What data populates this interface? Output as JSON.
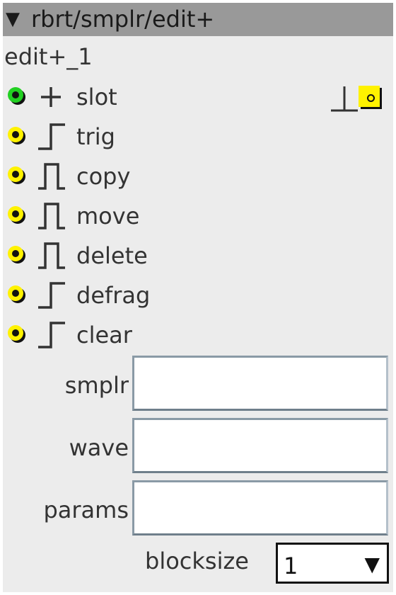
{
  "window": {
    "title": "rbrt/smplr/edit+",
    "collapse_glyph": "▼"
  },
  "node": {
    "name": "edit+_1"
  },
  "colors": {
    "port_green": "#22d022",
    "port_yellow": "#fff200",
    "titlebar": "#999999",
    "panel": "#ececec"
  },
  "inputs": [
    {
      "label": "slot",
      "port_color": "green",
      "signal_icon": "plus-icon",
      "signal_glyph": "+"
    },
    {
      "label": "trig",
      "port_color": "yellow",
      "signal_icon": "step-icon"
    },
    {
      "label": "copy",
      "port_color": "yellow",
      "signal_icon": "pulse-icon"
    },
    {
      "label": "move",
      "port_color": "yellow",
      "signal_icon": "pulse-icon"
    },
    {
      "label": "delete",
      "port_color": "yellow",
      "signal_icon": "pulse-icon"
    },
    {
      "label": "defrag",
      "port_color": "yellow",
      "signal_icon": "step-icon"
    },
    {
      "label": "clear",
      "port_color": "yellow",
      "signal_icon": "step-icon"
    }
  ],
  "output": {
    "icon": "bang-icon",
    "port_color": "yellow"
  },
  "fields": [
    {
      "label": "smplr",
      "value": ""
    },
    {
      "label": "wave",
      "value": ""
    },
    {
      "label": "params",
      "value": ""
    }
  ],
  "blocksize": {
    "label": "blocksize",
    "value": "1",
    "arrow": "▼"
  }
}
